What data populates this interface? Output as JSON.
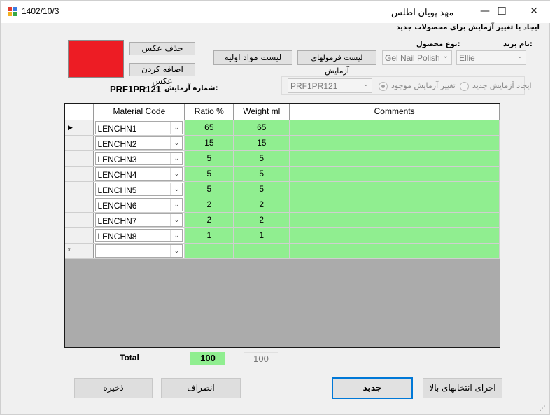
{
  "window": {
    "date": "1402/10/3",
    "title": "مهد پویان اطلس",
    "controls": {
      "minimize": "—",
      "maximize": "☐",
      "close": "✕"
    }
  },
  "group_title": "ایجاد یا تغییر آزمایش برای محصولات جدید",
  "image_color": "#ed1c24",
  "buttons": {
    "delete_image": "حذف عکس",
    "add_image": "اضافه کردن عکس",
    "raw_materials_list": "لیست مواد اولیه",
    "test_formulas_list": "لیست فرمولهای آزمایش",
    "new": "جدید",
    "apply_above": "اجرای انتخابهای بالا",
    "cancel": "انصراف",
    "save": "ذخیره"
  },
  "fields": {
    "brand_label": "نام برند:",
    "brand_value": "Ellie",
    "product_type_label": "نوع محصول:",
    "product_type_value": "Gel Nail Polish",
    "test_code_value": "PRF1PR121",
    "test_number_label": "شماره آزمایش:",
    "test_number_value": "PRF1PR121"
  },
  "radios": {
    "new_test": "ایجاد آزمایش جدید",
    "change_existing": "تغییر آزمایش موجود",
    "selected": "change_existing"
  },
  "grid": {
    "columns": [
      "Material Code",
      "Ratio %",
      "Weight ml",
      "Comments"
    ],
    "current_row_marker": "▶",
    "new_row_marker": "*",
    "rows": [
      {
        "code": "LENCHN1",
        "ratio": "65",
        "weight": "65",
        "comment": ""
      },
      {
        "code": "LENCHN2",
        "ratio": "15",
        "weight": "15",
        "comment": ""
      },
      {
        "code": "LENCHN3",
        "ratio": "5",
        "weight": "5",
        "comment": ""
      },
      {
        "code": "LENCHN4",
        "ratio": "5",
        "weight": "5",
        "comment": ""
      },
      {
        "code": "LENCHN5",
        "ratio": "5",
        "weight": "5",
        "comment": ""
      },
      {
        "code": "LENCHN6",
        "ratio": "2",
        "weight": "2",
        "comment": ""
      },
      {
        "code": "LENCHN7",
        "ratio": "2",
        "weight": "2",
        "comment": ""
      },
      {
        "code": "LENCHN8",
        "ratio": "1",
        "weight": "1",
        "comment": ""
      }
    ]
  },
  "totals": {
    "label": "Total",
    "ratio_total": "100",
    "weight_total": "100",
    "ratio_bg": "#90ee90"
  }
}
